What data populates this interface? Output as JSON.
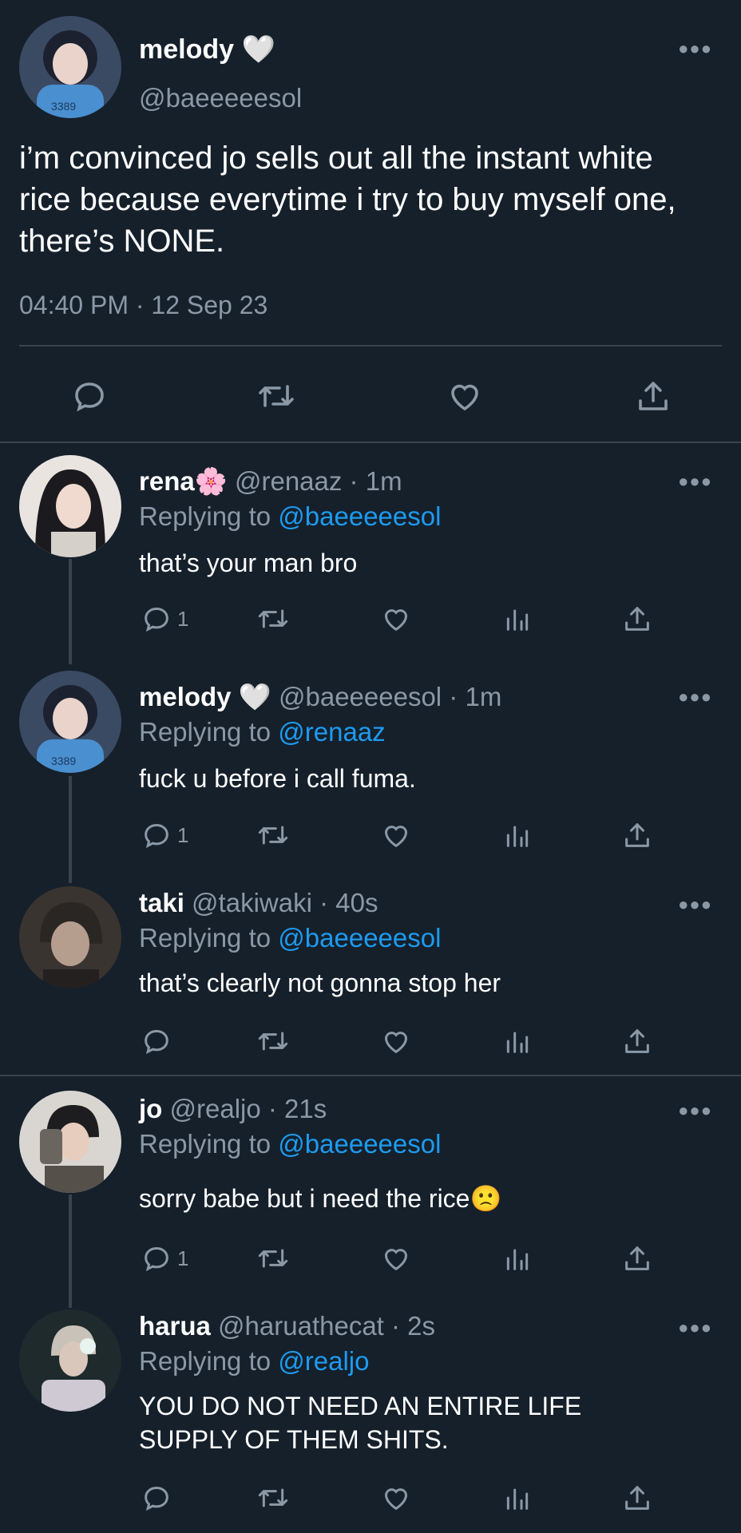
{
  "main_tweet": {
    "display_name": "melody",
    "name_emoji": "🤍",
    "handle": "@baeeeeesol",
    "text": "i’m convinced jo sells out all the instant white rice because everytime i try to buy myself one, there’s NONE.",
    "timestamp": "04:40 PM · 12 Sep 23",
    "more_icon": "more-horizontal-icon"
  },
  "replies": [
    {
      "display_name": "rena",
      "name_emoji": "🌸",
      "meta": "@renaaz · 1m",
      "replying_label": "Replying to",
      "replying_to": "@baeeeeesol",
      "text": "that’s your man bro",
      "reply_count": "1"
    },
    {
      "display_name": "melody",
      "name_emoji": "🤍",
      "meta": "@baeeeeesol · 1m",
      "replying_label": "Replying to",
      "replying_to": "@renaaz",
      "text": "fuck u before i call fuma.",
      "reply_count": "1"
    },
    {
      "display_name": "taki",
      "name_emoji": "",
      "meta": "@takiwaki · 40s",
      "replying_label": "Replying to",
      "replying_to": "@baeeeeesol",
      "text": "that’s clearly not gonna stop her",
      "reply_count": ""
    },
    {
      "display_name": "jo",
      "name_emoji": "",
      "meta": "@realjo · 21s",
      "replying_label": "Replying to",
      "replying_to": "@baeeeeesol",
      "text": "sorry babe but i need the rice🙁",
      "reply_count": "1"
    },
    {
      "display_name": "harua",
      "name_emoji": "",
      "meta": "@haruathecat · 2s",
      "replying_label": "Replying to",
      "replying_to": "@realjo",
      "text": "YOU DO NOT NEED AN ENTIRE LIFE SUPPLY OF THEM SHITS.",
      "reply_count": ""
    }
  ],
  "colors": {
    "background": "#15202b",
    "link": "#1d9bf0",
    "muted": "#8b98a5",
    "divider": "#38444d"
  },
  "icons": [
    "reply-icon",
    "retweet-icon",
    "like-icon",
    "views-icon",
    "share-icon",
    "more-horizontal-icon"
  ]
}
